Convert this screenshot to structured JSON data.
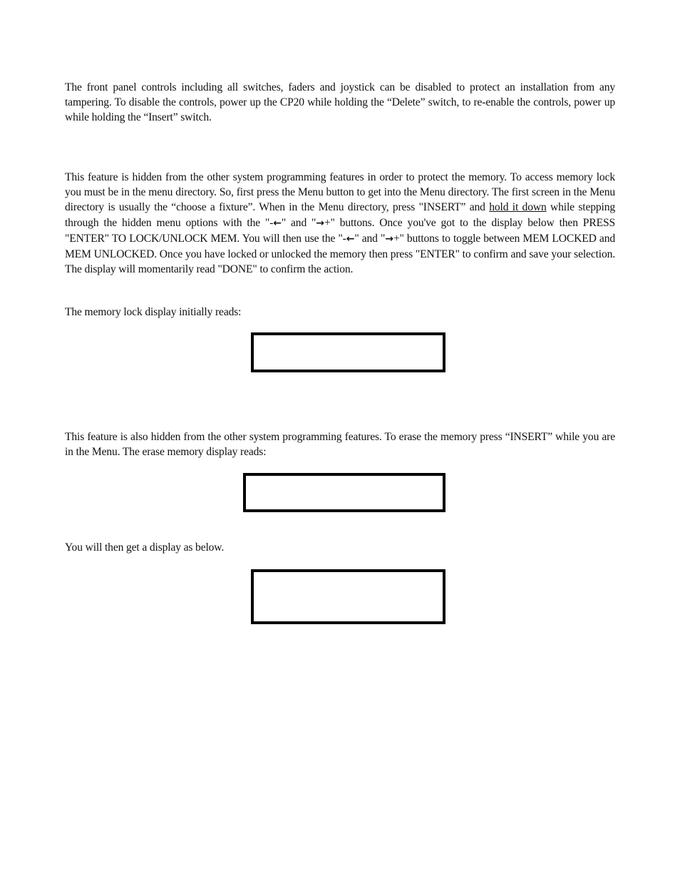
{
  "document": {
    "section_lockout": {
      "paragraph": "The front panel controls including all switches, faders and joystick can be disabled to protect an installation from any tampering. To disable the controls, power up the CP20 while holding the “Delete” switch, to re-enable the controls, power up while holding the “Insert” switch."
    },
    "section_memory_lock": {
      "paragraph_part1": "This feature is hidden from the other system programming features in order to protect the memory. To access memory lock you must be in the menu directory. So, first press the Menu button to get into the Menu directory. The first screen in the Menu directory is usually the “choose a fixture”. When in the Menu directory, press \"INSERT” and ",
      "paragraph_underlined": "hold it down",
      "paragraph_part2": " while stepping through the hidden menu options with the \"-",
      "arrow_left_icon": "←",
      "paragraph_part3": "\" and \"",
      "arrow_right_icon": "→",
      "paragraph_part4": "+\" buttons. Once you've got to the display below then PRESS \"ENTER\" TO LOCK/UNLOCK MEM.  You will then use the \"-",
      "paragraph_part5": "\" and \"",
      "paragraph_part6": "+\" buttons to toggle between MEM LOCKED and MEM UNLOCKED. Once you have locked or unlocked the memory then press \"ENTER\" to confirm and save your selection. The display will momentarily read \"DONE\" to confirm the action.",
      "display_intro": "The memory lock display initially reads:",
      "display_text": ""
    },
    "section_erase_memory": {
      "paragraph": "This feature is also hidden from the other system programming features. To erase the memory press “INSERT” while you are in the Menu. The erase memory display reads:",
      "display_text": "",
      "followup": "You will then get a display as below.",
      "followup_display_text": ""
    }
  }
}
